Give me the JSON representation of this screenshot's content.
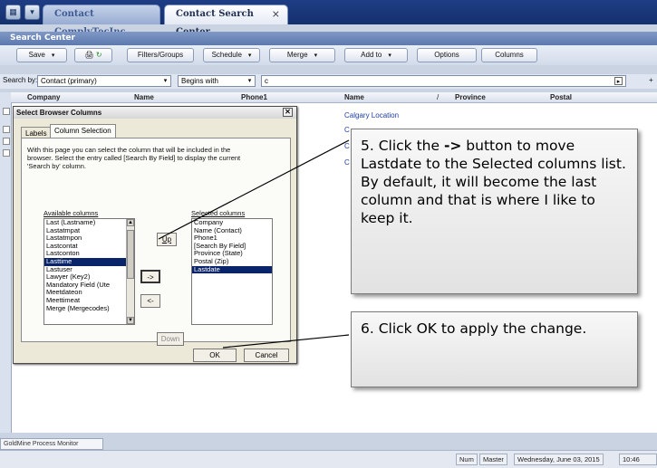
{
  "tabs": [
    {
      "label": "Contact ComplyTecInc."
    },
    {
      "label": "Contact Search Center",
      "close": "×"
    }
  ],
  "window_title": "Search Center",
  "toolbar": {
    "save": "Save",
    "filters": "Filters/Groups",
    "schedule": "Schedule",
    "merge": "Merge",
    "addto": "Add to",
    "options": "Options",
    "columns": "Columns"
  },
  "search": {
    "label": "Search by:",
    "field": "Contact (primary)",
    "condition": "Begins with",
    "value": "c"
  },
  "grid": {
    "headers": [
      "Company",
      "Name",
      "Phone1",
      "Name",
      "/",
      "Province",
      "Postal"
    ],
    "rows": [
      {
        "name": "Calgary Location"
      },
      {
        "name": "C"
      },
      {
        "name": "C"
      },
      {
        "name": "C"
      }
    ]
  },
  "dialog": {
    "title": "Select Browser Columns",
    "close": "✕",
    "tabs": [
      "Labels",
      "Column Selection"
    ],
    "description": "With this page you can select the column that will be included in the browser. Select the entry called [Search By Field] to display the current 'Search by' column.",
    "available_label": "Available columns",
    "selected_label": "Selected columns",
    "available": [
      "Last  (Lastname)",
      "Lastatmpat",
      "Lastatmpon",
      "Lastcontat",
      "Lastconton",
      "Lasttime",
      "Lastuser",
      "Lawyer  (Key2)",
      "Mandatory Field  (Ute",
      "Meetdateon",
      "Meettimeat",
      "Merge  (Mergecodes)"
    ],
    "available_selected": "Lasttime",
    "selected": [
      "Company",
      "Name  (Contact)",
      "Phone1",
      "  [Search By Field]",
      "Province  (State)",
      "Postal  (Zip)",
      "Lastdate"
    ],
    "selected_highlight": "Lastdate",
    "buttons": {
      "up": "Up",
      "add": "->",
      "remove": "<-",
      "down": "Down",
      "ok": "OK",
      "cancel": "Cancel"
    }
  },
  "callouts": [
    {
      "prefix": "5. Click the ",
      "bold": "->",
      "suffix": " button to move Lastdate to the Selected columns list. By default, it will become the last column and that is where I like to keep it."
    },
    {
      "text": "6. Click OK to apply the change."
    }
  ],
  "statusbar": {
    "monitor": "GoldMine Process Monitor",
    "num": "Num",
    "master": "Master",
    "date": "Wednesday, June 03, 2015",
    "time": "10:46 "
  },
  "colors": {
    "accent": "#1e3d84",
    "selection": "#0a246a"
  }
}
